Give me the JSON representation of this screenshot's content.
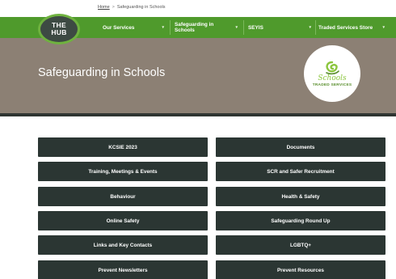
{
  "breadcrumb": {
    "home": "Home",
    "separator": ">",
    "current": "Safeguarding in Schools"
  },
  "logo": {
    "line1": "THE",
    "line2": "HUB"
  },
  "nav": {
    "items": [
      {
        "label": "Our Services",
        "caret": "▾"
      },
      {
        "label": "Safeguarding in Schools",
        "caret": "▾"
      },
      {
        "label": "SEYIS",
        "caret": "▾"
      },
      {
        "label": "Traded Services Store",
        "caret": "▾"
      }
    ]
  },
  "hero": {
    "title": "Safeguarding in Schools",
    "badge": {
      "script": "Schools",
      "sub": "TRADED SERVICES",
      "icon": "swirl-logo-icon"
    }
  },
  "buttons": {
    "left": [
      "KCSIE 2023",
      "Training, Meetings & Events",
      "Behaviour",
      "Online Safety",
      "Links and Key Contacts",
      "Prevent Newsletters"
    ],
    "right": [
      "Documents",
      "SCR and Safer Recruitment",
      "Health & Safety",
      "Safeguarding Round Up",
      "LGBTQ+",
      "Prevent Resources"
    ]
  },
  "colors": {
    "nav_green": "#4f9a2c",
    "hero": "#8c8074",
    "button": "#2b3633",
    "logo_bg": "#3d4a43",
    "accent_green": "#8cc63f"
  }
}
